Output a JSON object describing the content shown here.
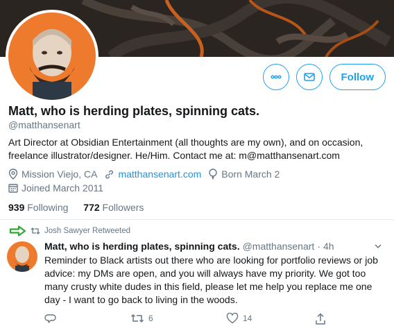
{
  "profile": {
    "display_name": "Matt, who is herding plates, spinning cats.",
    "handle": "@matthansenart",
    "bio": "Art Director at Obsidian Entertainment (all thoughts are my own), and on occasion, freelance illustrator/designer. He/Him. Contact me at: m@matthansenart.com",
    "location": "Mission Viejo, CA",
    "website": "matthansenart.com",
    "born": "Born March 2",
    "joined": "Joined March 2011",
    "following_count": "939",
    "following_label": "Following",
    "followers_count": "772",
    "followers_label": "Followers",
    "follow_button": "Follow"
  },
  "tweet": {
    "retweeted_by": "Josh Sawyer Retweeted",
    "author_name": "Matt, who is herding plates, spinning cats.",
    "author_handle": "@matthansenart",
    "separator": "·",
    "time": "4h",
    "text": "Reminder to Black artists out there who are looking for portfolio reviews or job advice: my DMs are open, and you will always have my priority. We got too many crusty white dudes in this field, please let me help you replace me one day - I want to go back to living in the woods.",
    "retweets": "6",
    "likes": "14"
  },
  "colors": {
    "accent": "#1da1f2",
    "link": "#1b95e0",
    "secondary_text": "#657786",
    "annotation_arrow": "#2fa82f"
  },
  "icons": [
    "more-icon",
    "message-icon",
    "location-icon",
    "link-icon",
    "birthday-icon",
    "calendar-icon",
    "retweet-icon",
    "reply-icon",
    "like-icon",
    "share-icon",
    "chevron-down-icon",
    "green-arrow-icon"
  ]
}
